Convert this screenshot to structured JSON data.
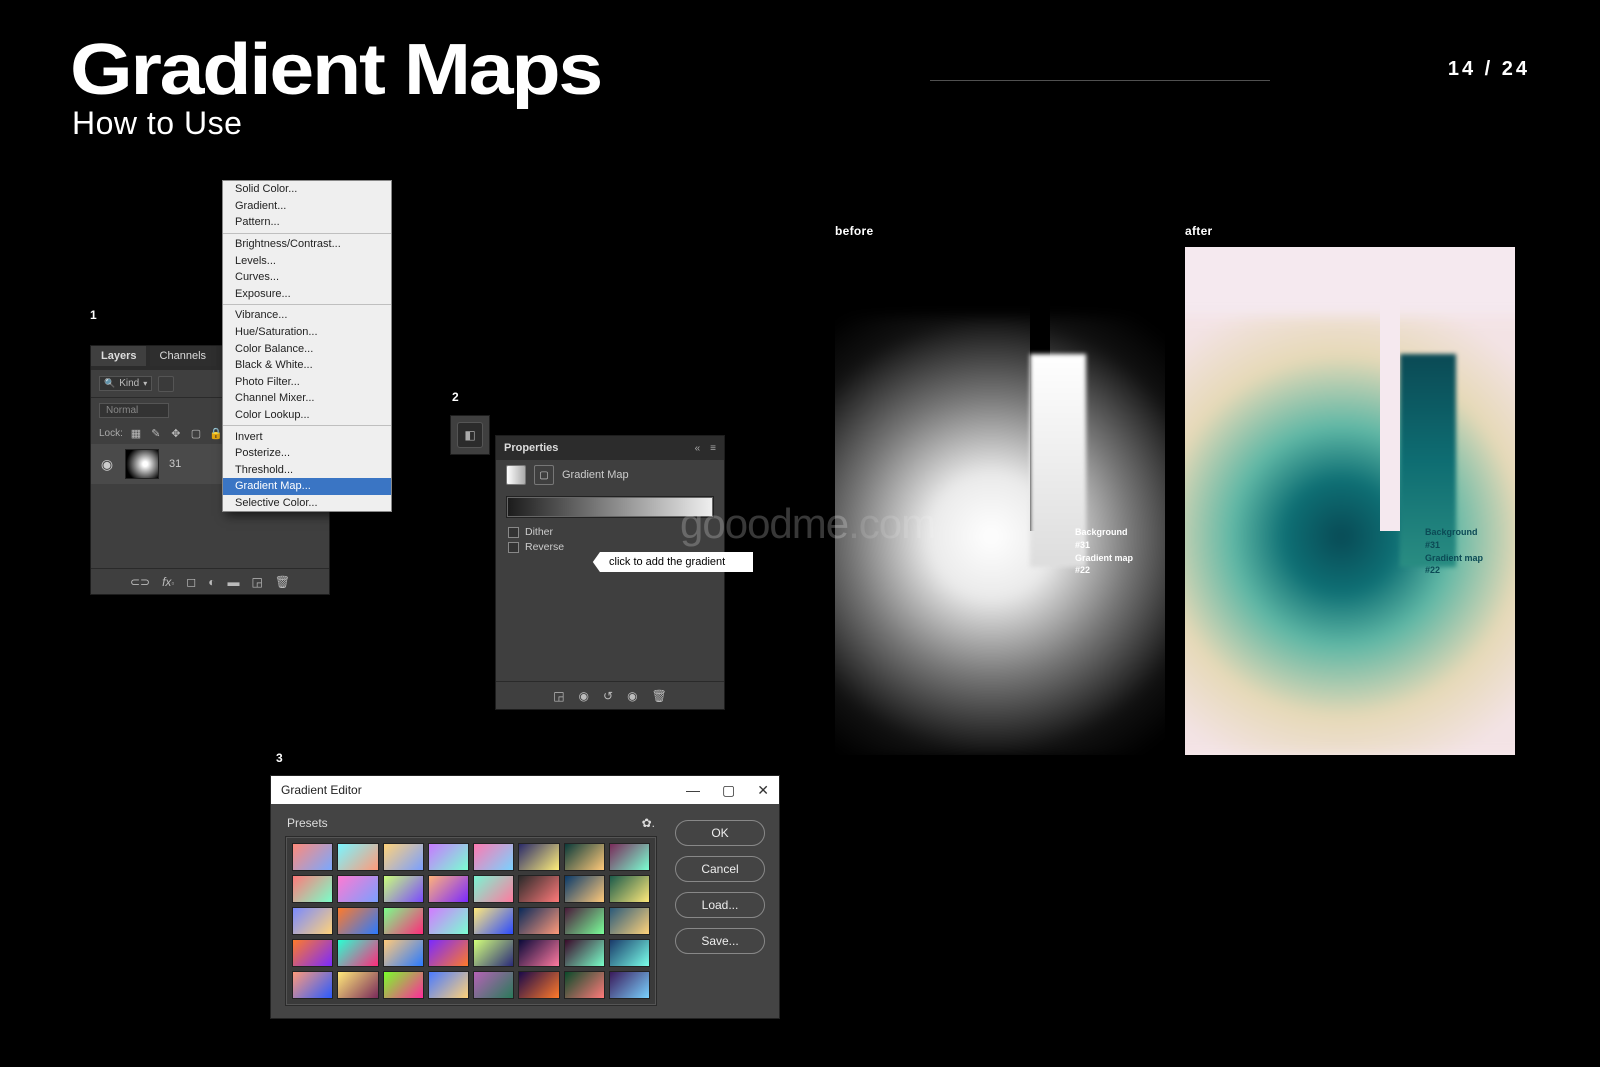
{
  "header": {
    "title": "Gradient Maps",
    "subtitle": "How to Use",
    "pager": "14 / 24"
  },
  "steps": {
    "s1": "1",
    "s2": "2",
    "s3": "3"
  },
  "layers_panel": {
    "tab_layers": "Layers",
    "tab_channels": "Channels",
    "kind": "Kind",
    "normal": "Normal",
    "lock": "Lock:",
    "layer_name": "31"
  },
  "adj_menu": {
    "g1": [
      "Solid Color...",
      "Gradient...",
      "Pattern..."
    ],
    "g2": [
      "Brightness/Contrast...",
      "Levels...",
      "Curves...",
      "Exposure..."
    ],
    "g3": [
      "Vibrance...",
      "Hue/Saturation...",
      "Color Balance...",
      "Black & White...",
      "Photo Filter...",
      "Channel Mixer...",
      "Color Lookup..."
    ],
    "g4": [
      "Invert",
      "Posterize...",
      "Threshold...",
      "Gradient Map...",
      "Selective Color..."
    ],
    "selected": "Gradient Map..."
  },
  "properties": {
    "title": "Properties",
    "subhead": "Gradient Map",
    "dither": "Dither",
    "reverse": "Reverse",
    "tooltip": "click to add the gradient"
  },
  "grad_editor": {
    "title": "Gradient Editor",
    "presets": "Presets",
    "btn_ok": "OK",
    "btn_cancel": "Cancel",
    "btn_load": "Load...",
    "btn_save": "Save...",
    "swatches": [
      "linear-gradient(135deg,#ff8a7a,#7aa8ff)",
      "linear-gradient(135deg,#7af5ff,#ff9a7a)",
      "linear-gradient(135deg,#ffd27a,#7a9fff)",
      "linear-gradient(135deg,#c77aff,#7affd2)",
      "linear-gradient(135deg,#ff7ab1,#7ad2ff)",
      "linear-gradient(135deg,#2a2a6a,#ffef7a)",
      "linear-gradient(135deg,#0a3a3a,#ffc97a)",
      "linear-gradient(135deg,#7a2a5a,#7affd2)",
      "linear-gradient(135deg,#ff7a7a,#7affc9)",
      "linear-gradient(135deg,#ff7ad2,#7a9fff)",
      "linear-gradient(135deg,#c9ff7a,#7a4aff)",
      "linear-gradient(135deg,#ffb27a,#7a2aff)",
      "linear-gradient(135deg,#7af5d2,#ff7a9f)",
      "linear-gradient(135deg,#2a2a2a,#ff7a7a)",
      "linear-gradient(135deg,#0a3a6a,#ffc97a)",
      "linear-gradient(135deg,#1a5a4a,#ffe97a)",
      "linear-gradient(135deg,#7a8aff,#ffd27a)",
      "linear-gradient(135deg,#ff7a2a,#2a7aff)",
      "linear-gradient(135deg,#7aff8a,#ff2a7a)",
      "linear-gradient(135deg,#d27aff,#7affd2)",
      "linear-gradient(135deg,#ffe97a,#2a4aff)",
      "linear-gradient(135deg,#0a2a5a,#ff9a7a)",
      "linear-gradient(135deg,#4a1a3a,#7aff9a)",
      "linear-gradient(135deg,#2a5a7a,#ffd27a)",
      "linear-gradient(135deg,#ff7a2a,#7a2aff)",
      "linear-gradient(135deg,#2affd2,#ff2a7a)",
      "linear-gradient(135deg,#ffc97a,#2a7aff)",
      "linear-gradient(135deg,#7a2aff,#ff7a2a)",
      "linear-gradient(135deg,#d2ff7a,#2a2a7a)",
      "linear-gradient(135deg,#0a0a3a,#ff7a9f)",
      "linear-gradient(135deg,#3a0a2a,#7affc9)",
      "linear-gradient(135deg,#1a3a6a,#7affe9)",
      "linear-gradient(135deg,#ff9a7a,#2a5aff)",
      "linear-gradient(135deg,#ffe97a,#7a2a5a)",
      "linear-gradient(135deg,#7aff2a,#ff2a9a)",
      "linear-gradient(135deg,#4a7aff,#ffd27a)",
      "linear-gradient(135deg,#ff7affa0,#2a7a5a)",
      "linear-gradient(135deg,#1a0a4a,#ff7a2a)",
      "linear-gradient(135deg,#0a4a2a,#ff7a7a)",
      "linear-gradient(135deg,#3a1a5a,#7ad2ff)"
    ]
  },
  "ba": {
    "before": "before",
    "after": "after",
    "cap1": "Background",
    "cap2": "#31",
    "cap3": "Gradient map",
    "cap4": "#22"
  },
  "watermark": {
    "a": "gooodme",
    "b": ".com"
  }
}
